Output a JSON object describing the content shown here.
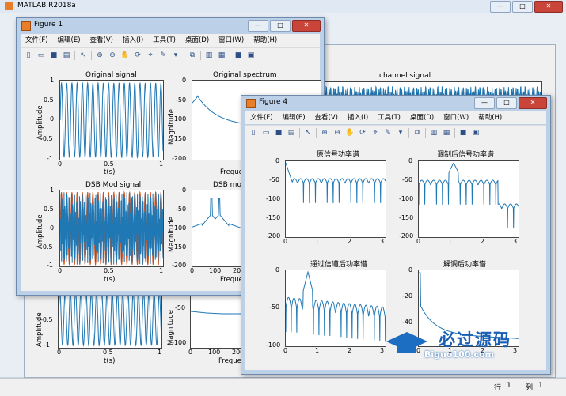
{
  "app": {
    "title": "MATLAB R2018a"
  },
  "status": {
    "row_label": "行",
    "row_value": "1",
    "col_label": "列",
    "col_value": "1"
  },
  "figure1": {
    "title": "Figure 1",
    "menu": [
      "文件(F)",
      "编辑(E)",
      "查看(V)",
      "插入(I)",
      "工具(T)",
      "桌面(D)",
      "窗口(W)",
      "帮助(H)"
    ],
    "plots": {
      "p1": {
        "title": "Original signal",
        "xlabel": "t(s)",
        "ylabel": "Amplitude",
        "yticks": [
          "1",
          "0.5",
          "0",
          "-0.5",
          "-1"
        ],
        "xticks": [
          "0",
          "0.5",
          "1"
        ]
      },
      "p2": {
        "title": "Original spectrum",
        "xlabel": "Frequer",
        "ylabel": "Magnitude",
        "yticks": [
          "0",
          "-50",
          "-100",
          "-150",
          "-200"
        ]
      },
      "p3": {
        "title": "DSB Mod signal",
        "xlabel": "t(s)",
        "ylabel": "Amplitude",
        "yticks": [
          "1",
          "0.5",
          "0",
          "-0.5",
          "-1"
        ],
        "xticks": [
          "0",
          "0.5",
          "1"
        ]
      },
      "p4": {
        "title": "DSB mod",
        "xlabel": "Frequer",
        "ylabel": "Magnitude",
        "yticks": [
          "0",
          "-50",
          "-100",
          "-150",
          "-200"
        ],
        "xticks": [
          "0",
          "100",
          "200"
        ]
      }
    }
  },
  "background_plots": {
    "channel_title": "channel signal",
    "bl_xlabel": "t(s)",
    "bl_ylabel": "Amplitude",
    "bl_yticks": [
      "0",
      "-0.5",
      "-1"
    ],
    "bl_xticks": [
      "0",
      "0.5",
      "1"
    ],
    "bm_xlabel": "Frequer",
    "bm_ylabel": "Magnitude",
    "bm_yticks": [
      "-50",
      "-100"
    ],
    "bm_xticks": [
      "0",
      "100",
      "200"
    ]
  },
  "figure4": {
    "title": "Figure 4",
    "menu": [
      "文件(F)",
      "编辑(E)",
      "查看(V)",
      "插入(I)",
      "工具(T)",
      "桌面(D)",
      "窗口(W)",
      "帮助(H)"
    ],
    "plots": {
      "p1": {
        "title": "原信号功率谱",
        "yticks": [
          "0",
          "-50",
          "-100",
          "-150",
          "-200"
        ],
        "xticks": [
          "0",
          "1",
          "2",
          "3"
        ]
      },
      "p2": {
        "title": "调制后信号功率谱",
        "yticks": [
          "0",
          "-50",
          "-100",
          "-150",
          "-200"
        ],
        "xticks": [
          "0",
          "1",
          "2",
          "3"
        ]
      },
      "p3": {
        "title": "通过信道后功率谱",
        "yticks": [
          "0",
          "-50",
          "-100"
        ],
        "xticks": [
          "0",
          "1",
          "2",
          "3"
        ]
      },
      "p4": {
        "title": "解调后功率谱",
        "yticks": [
          "0",
          "-20",
          "-40"
        ],
        "xticks": [
          "0",
          "1",
          "2",
          "3"
        ]
      }
    }
  },
  "watermark": {
    "text": "必过源码",
    "url": "Biguo100.com"
  },
  "colors": {
    "line": "#1f77b4",
    "mod_orange": "#d95319"
  }
}
